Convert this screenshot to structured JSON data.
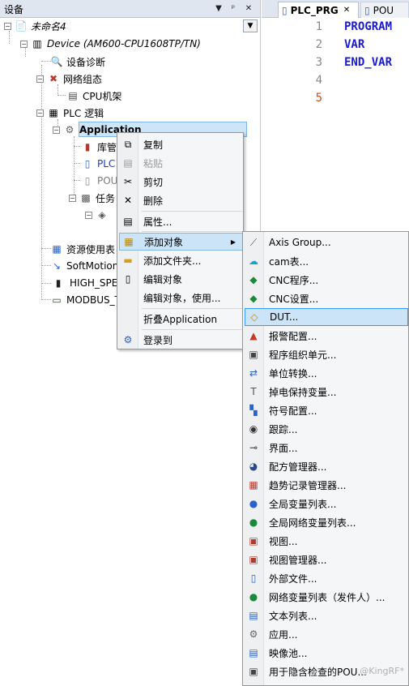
{
  "panel": {
    "title": "设备",
    "pin_glyph": "▼",
    "pin2_glyph": "ᵖ",
    "close_glyph": "✕",
    "dropdown_glyph": "▼"
  },
  "tree": {
    "root": "未命名4",
    "device": "Device (AM600-CPU1608TP/TN)",
    "diag": "设备诊断",
    "net": "网络组态",
    "cpu_rack": "CPU机架",
    "plc_logic": "PLC 逻辑",
    "application": "Application",
    "lib": "库管",
    "plc_prg": "PLC",
    "pou": "POU",
    "task": "任务",
    "res": "资源使用表",
    "softmotion": "SoftMotion G",
    "high_speed": "HIGH_SPE",
    "modbus": "MODBUS_TC"
  },
  "editor": {
    "tab_plc": "PLC_PRG",
    "tab_pou": "POU",
    "tab_close": "✕",
    "line_numbers": [
      "1",
      "2",
      "3",
      "4",
      "5"
    ],
    "code": [
      "PROGRAM",
      "VAR",
      "END_VAR"
    ]
  },
  "context_menu": {
    "copy": "复制",
    "paste": "粘贴",
    "cut": "剪切",
    "delete": "删除",
    "properties": "属性...",
    "add_object": "添加对象",
    "add_folder": "添加文件夹...",
    "edit_object": "编辑对象",
    "edit_object_with": "编辑对象，使用...",
    "fold_application": "折叠Application",
    "login": "登录到"
  },
  "submenu": {
    "items": [
      "Axis Group...",
      "cam表...",
      "CNC程序...",
      "CNC设置...",
      "DUT...",
      "报警配置...",
      "程序组织单元...",
      "单位转换...",
      "掉电保持变量...",
      "符号配置...",
      "跟踪...",
      "界面...",
      "配方管理器...",
      "趋势记录管理器...",
      "全局变量列表...",
      "全局网络变量列表...",
      "视图...",
      "视图管理器...",
      "外部文件...",
      "网络变量列表（发件人）...",
      "文本列表...",
      "应用...",
      "映像池...",
      "用于隐含检查的POU..."
    ],
    "highlighted_index": 4
  },
  "watermark": "@KingRF*",
  "colors": {
    "selection": "#cde6f7",
    "menu_highlight": "#cce4f7",
    "code_keyword": "#1a1ad0",
    "active_line_no": "#d04a1a"
  }
}
